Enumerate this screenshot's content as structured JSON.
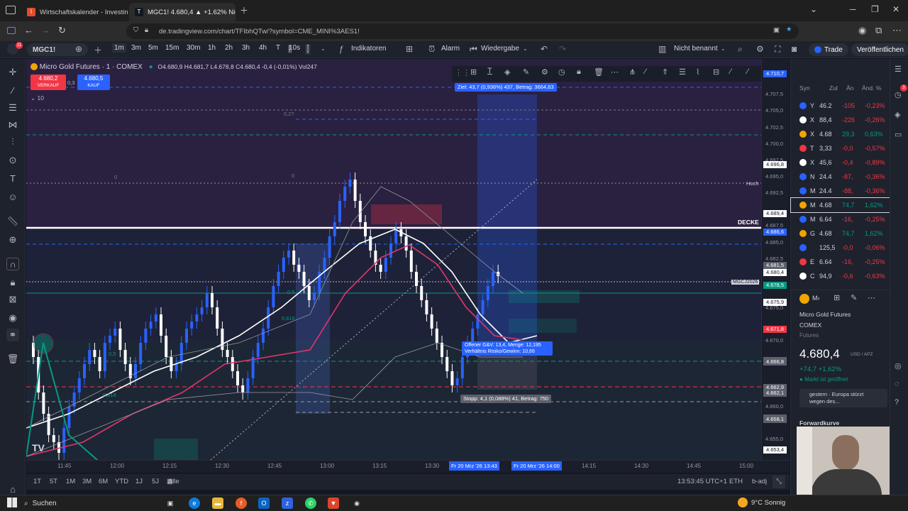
{
  "browser": {
    "tabs": [
      {
        "label": "Wirtschaftskalender - Investing",
        "fav": "I"
      },
      {
        "label": "MGC1! 4.680,4 ▲ +1.62% Nicht",
        "fav": "T"
      }
    ],
    "url": "de.tradingview.com/chart/TFIbhQTw/?symbol=CME_MINI%3AES1!"
  },
  "toolbar": {
    "symbol": "MGC1!",
    "intervals": [
      "1m",
      "3m",
      "5m",
      "15m",
      "30m",
      "1h",
      "2h",
      "3h",
      "4h",
      "T",
      "10s"
    ],
    "indicators_label": "Indikatoren",
    "alarm_label": "Alarm",
    "replay_label": "Wiedergabe",
    "layout_name": "Nicht benannt",
    "trade_label": "Trade",
    "publish_label": "Veröffentlichen"
  },
  "legend": {
    "title": "Micro Gold Futures · 1 · COMEX",
    "ohlc": "O4.680,9  H4.681,7  L4.678,8  C4.680,4  -0,4 (-0,01%)  Vol247",
    "sell_price": "4.680,2",
    "sell_label": "VERKAUF",
    "spread": "0,3",
    "buy_price": "4.680,5",
    "buy_label": "KAUF",
    "indicator_count": "10"
  },
  "chart_labels": {
    "target": "Ziel: 43,7 (0,936%) 437, Betrag: 3664,63",
    "position_info_1": "Offener G&V: 13,4, Menge: 12,195",
    "position_info_2": "Verhältnis Risiko/Gewinn: 10,66",
    "stop": "Stopp: 4,1 (0,088%) 41, Betrag: 750",
    "decke": "DECKE",
    "hoch": "Hoch",
    "symbol_tag": "MGCJ2026",
    "fib_05": "0,5",
    "fib_0618": "0,618",
    "fib_0": "0",
    "fib_027": "0,27"
  },
  "price_axis": [
    "4.710,7",
    "4.707,5",
    "4.705,0",
    "4.702,5",
    "4.700,0",
    "4.697,5",
    "4.696,8",
    "4.695,0",
    "4.692,5",
    "4.689,4",
    "4.687,5",
    "4.686,6",
    "4.685,0",
    "4.682,5",
    "4.681,5",
    "4.680,4",
    "4.678,5",
    "4.675,9",
    "4.675,0",
    "4.671,8",
    "4.670,0",
    "4.667,0",
    "4.666,8",
    "4.662,9",
    "4.662,1",
    "4.660,0",
    "4.658,3",
    "4.658,1",
    "4.655,0",
    "4.653,4"
  ],
  "time_axis": [
    "11:45",
    "12:00",
    "12:15",
    "12:30",
    "12:45",
    "13:00",
    "13:15",
    "13:30",
    "13:43",
    "14:00",
    "14:15",
    "14:30",
    "14:45",
    "15:00"
  ],
  "time_highlight_1": "Fr 20 Mrz '26   13:43",
  "time_highlight_2": "Fr 20 Mrz '26   14:00",
  "ranges": [
    "1T",
    "5T",
    "1M",
    "3M",
    "6M",
    "YTD",
    "1J",
    "5J",
    "Alle"
  ],
  "status": {
    "clock": "13:53:45 UTC+1",
    "session": "ETH",
    "adj": "b-adj"
  },
  "watchlist": {
    "headers": [
      "Syn",
      "Zul",
      "Än",
      "Änd. %"
    ],
    "rows": [
      {
        "sym": "Y",
        "last": "46.2",
        "chg": "-105",
        "pct": "-0,23%",
        "up": false
      },
      {
        "sym": "X",
        "last": "88,4",
        "chg": "-226",
        "pct": "-0,26%",
        "up": false
      },
      {
        "sym": "X",
        "last": "4.68",
        "chg": "29,3",
        "pct": "0,63%",
        "up": true
      },
      {
        "sym": "T",
        "last": "3,33",
        "chg": "-0,0",
        "pct": "-0,57%",
        "up": false
      },
      {
        "sym": "X",
        "last": "45,6",
        "chg": "-0,4",
        "pct": "-0,89%",
        "up": false
      },
      {
        "sym": "N",
        "last": "24.4",
        "chg": "-87,",
        "pct": "-0,36%",
        "up": false
      },
      {
        "sym": "M",
        "last": "24.4",
        "chg": "-88,",
        "pct": "-0,36%",
        "up": false
      },
      {
        "sym": "M",
        "last": "4.68",
        "chg": "74,7",
        "pct": "1,62%",
        "up": true
      },
      {
        "sym": "M",
        "last": "6.64",
        "chg": "-16,",
        "pct": "-0,25%",
        "up": false
      },
      {
        "sym": "G",
        "last": "4.68",
        "chg": "74,7",
        "pct": "1,62%",
        "up": true
      },
      {
        "sym": "",
        "last": "125,5",
        "chg": "-0,0",
        "pct": "-0,06%",
        "up": false
      },
      {
        "sym": "E",
        "last": "6.64",
        "chg": "-16,",
        "pct": "-0,25%",
        "up": false
      },
      {
        "sym": "C",
        "last": "94,9",
        "chg": "-0,6",
        "pct": "-0,63%",
        "up": false
      }
    ]
  },
  "details": {
    "name": "Micro Gold Futures",
    "exchange": "COMEX",
    "type": "Futures",
    "price": "4.680,4",
    "unit": "USD / APZ",
    "change": "+74,7  +1,62%",
    "market_status": "Markt ist geöffnet",
    "news": "gestern · Europa stürzt wegen des...",
    "forward_curve": "Forwardkurve"
  },
  "taskbar": {
    "search": "Suchen",
    "weather": "9°C  Sonnig"
  },
  "colors": {
    "up": "#2962ff",
    "down": "#f23645",
    "green": "#089981",
    "accent": "#2962ff"
  }
}
